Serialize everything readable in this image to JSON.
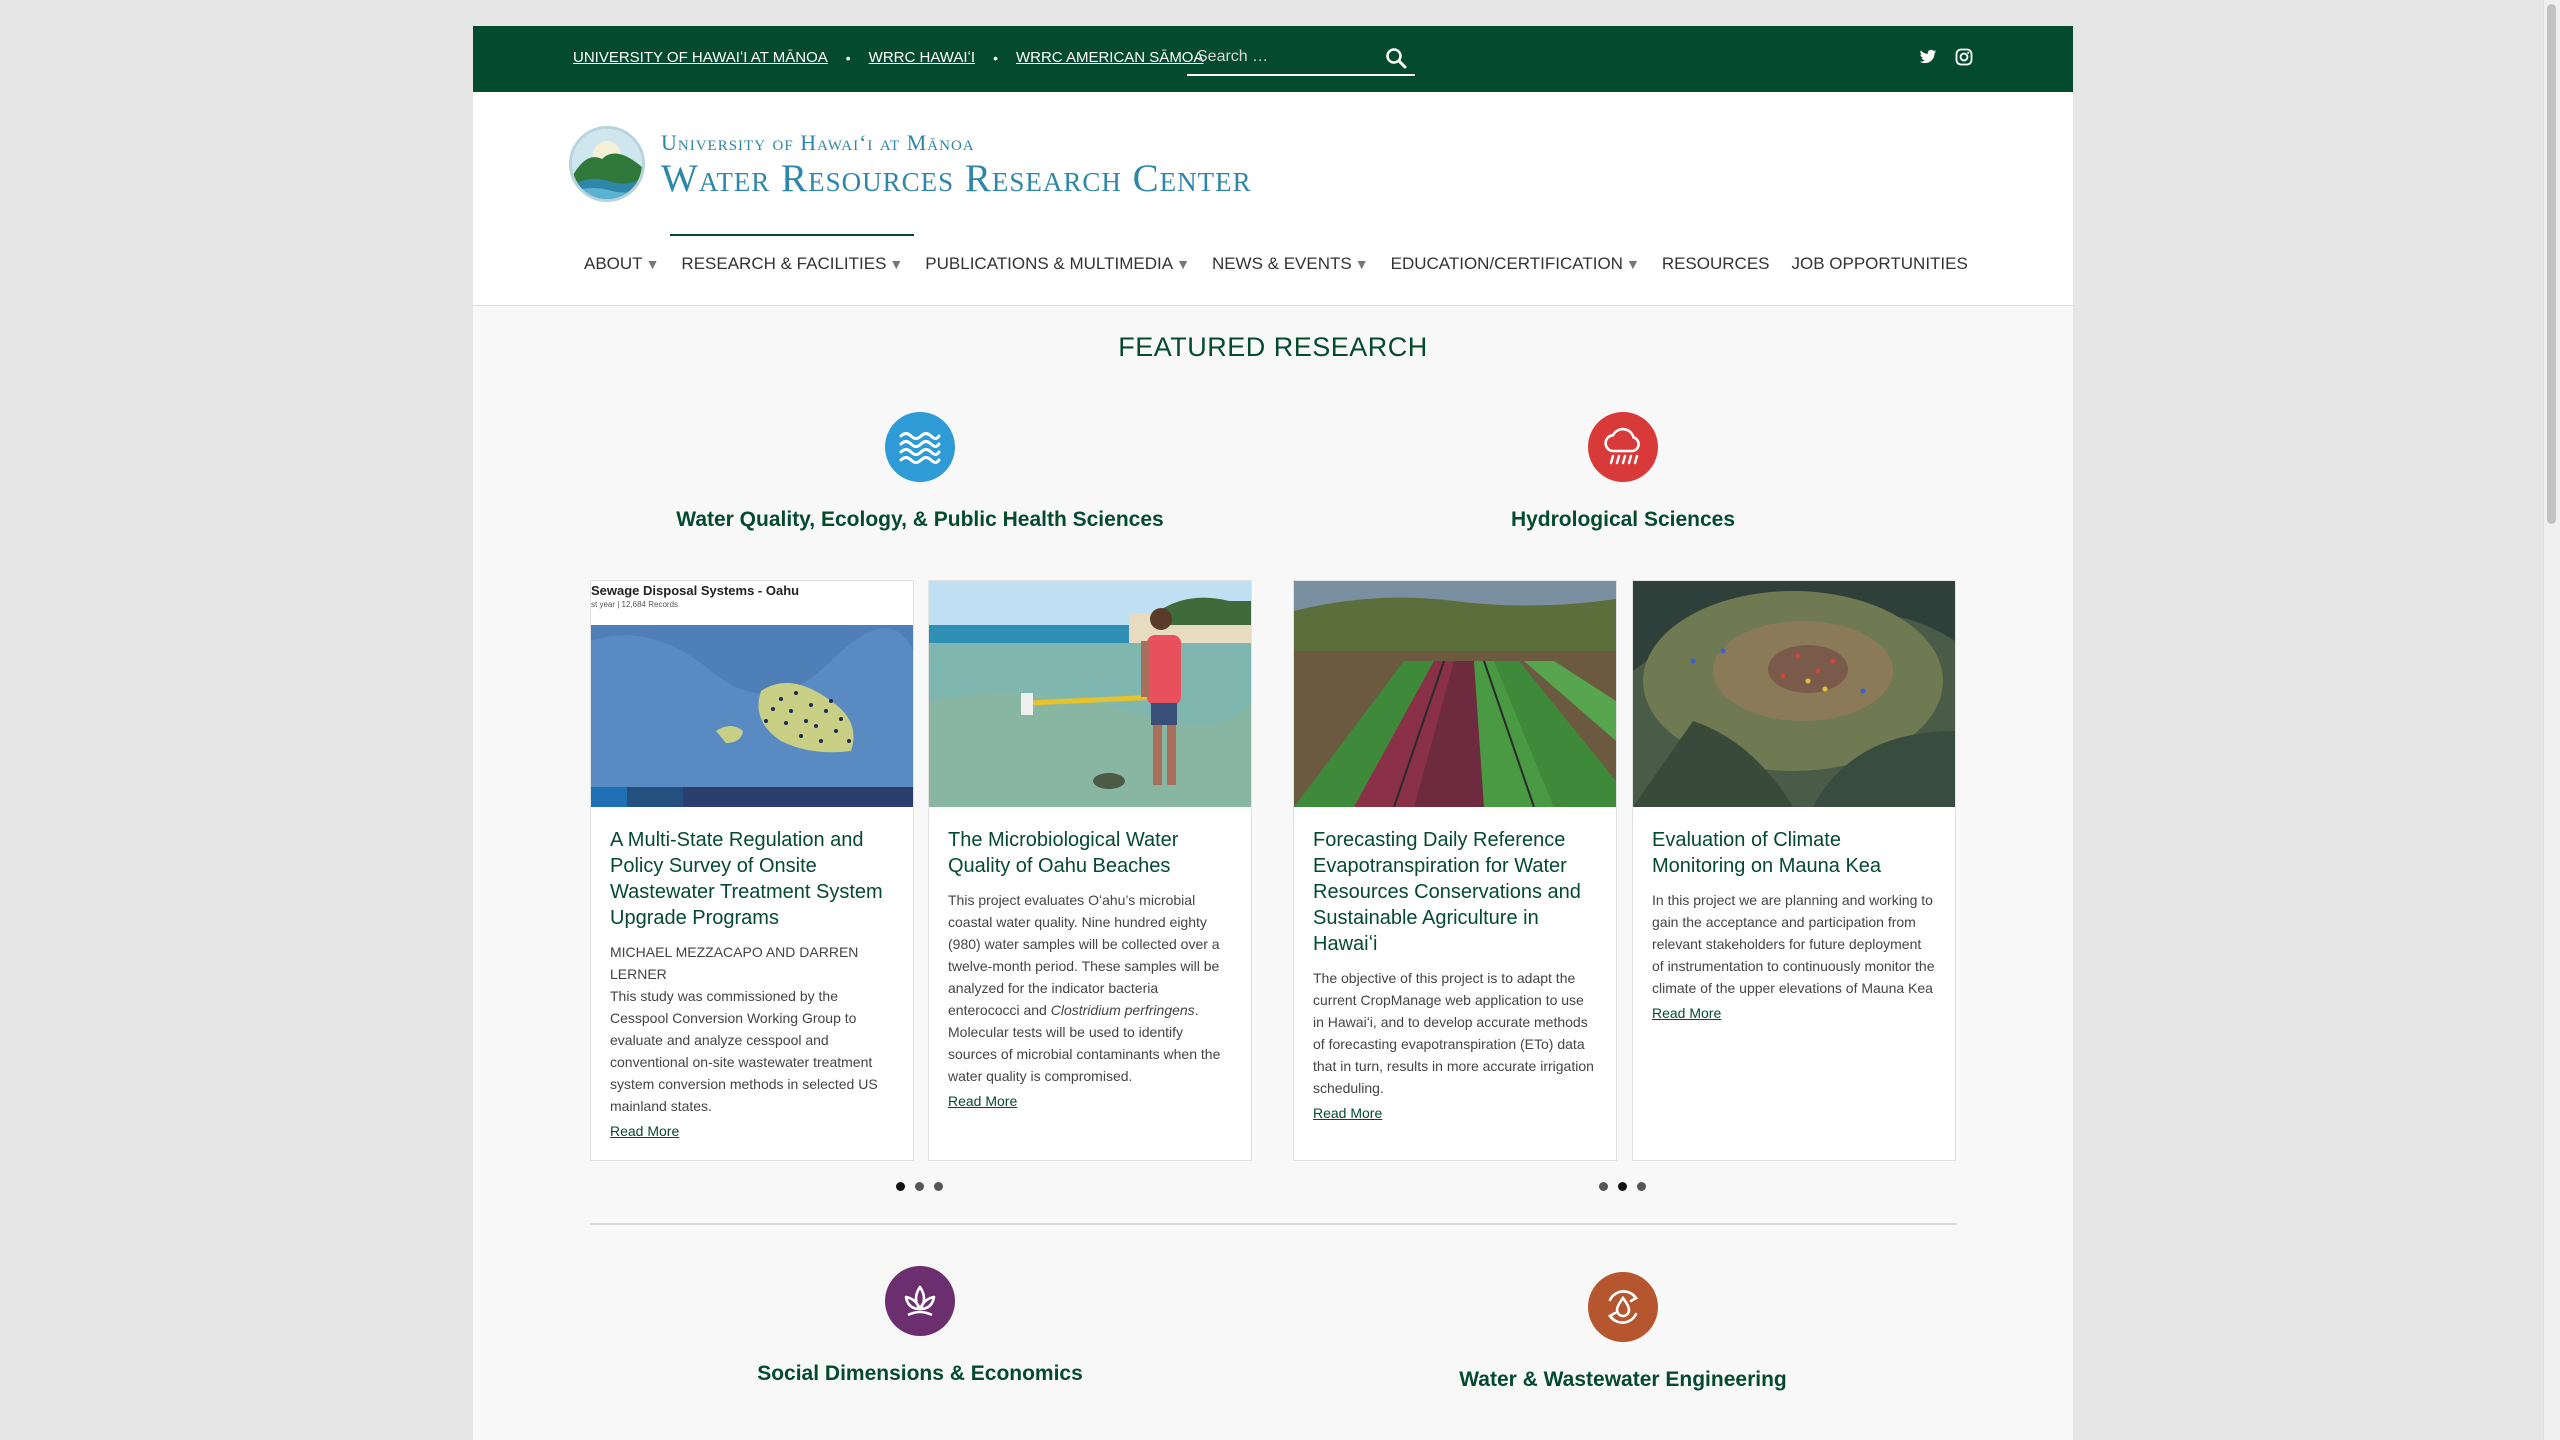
{
  "topbar": {
    "links": [
      "UNIVERSITY OF HAWAIʻI AT MĀNOA",
      "WRRC HAWAIʻI",
      "WRRC AMERICAN SĀMOA"
    ],
    "search_placeholder": "Search …",
    "social_icons": [
      "twitter-icon",
      "instagram-icon"
    ]
  },
  "brand": {
    "line1": "University of Hawaiʻi at Mānoa",
    "line2": "Water Resources Research Center"
  },
  "nav": [
    {
      "label": "ABOUT",
      "caret": "▼"
    },
    {
      "label": "RESEARCH & FACILITIES",
      "caret": "▼"
    },
    {
      "label": "PUBLICATIONS & MULTIMEDIA",
      "caret": "▼"
    },
    {
      "label": "NEWS & EVENTS",
      "caret": "▼"
    },
    {
      "label": "EDUCATION/CERTIFICATION",
      "caret": "▼"
    },
    {
      "label": "RESOURCES",
      "caret": ""
    },
    {
      "label": "JOB OPPORTUNITIES",
      "caret": ""
    }
  ],
  "featured_title": "FEATURED RESEARCH",
  "categories": [
    {
      "title": "Water Quality, Ecology, & Public Health Sciences",
      "icon": "water-waves-icon",
      "color": "#2e9ad6"
    },
    {
      "title": "Hydrological Sciences",
      "icon": "rain-cloud-icon",
      "color": "#d83a3a"
    },
    {
      "title": "Social Dimensions & Economics",
      "icon": "leaf-sprout-icon",
      "color": "#6b2e6e"
    },
    {
      "title": "Water & Wastewater Engineering",
      "icon": "recycle-drop-icon",
      "color": "#b5562e"
    }
  ],
  "cards": [
    {
      "title": "A Multi-State Regulation and Policy Survey of Onsite Wastewater Treatment System Upgrade Programs",
      "byline": "MICHAEL MEZZACAPO and DARREN LERNER",
      "text": "This study was commissioned by the Cesspool Conversion Working Group to evaluate and analyze cesspool and conventional on-site wastewater treatment system conversion methods in selected US mainland states.",
      "more": "Read More",
      "image_caption": "Sewage Disposal Systems - Oahu",
      "image_sub": "st year | 12,684 Records"
    },
    {
      "title": "The Microbiological Water Quality of Oahu Beaches",
      "text_a": "This project evaluates Oʻahu’s microbial coastal water quality. Nine hundred eighty (980) water samples will be collected over a twelve-month period. These samples will be analyzed for the indicator bacteria enterococci and ",
      "text_em": "Clostridium perfringens",
      "text_b": ". Molecular tests will be used to identify sources of microbial contaminants when the water quality is compromised.",
      "more": "Read More"
    },
    {
      "title": "Forecasting Daily Reference Evapotranspiration for Water Resources Conservations and Sustainable Agriculture in Hawaiʻi",
      "text": "The objective of this project is to adapt the current CropManage web application to use in Hawaiʻi, and to develop accurate methods of forecasting evapotranspiration (ETo) data that in turn, results in more accurate irrigation scheduling.",
      "more": "Read More"
    },
    {
      "title": "Evaluation of Climate Monitoring on Mauna Kea",
      "text": "In this project we are planning and working to gain the acceptance and participation from relevant stakeholders for future deployment of instrumentation to continuously monitor the climate of the upper elevations of Mauna Kea",
      "more": "Read More"
    }
  ]
}
